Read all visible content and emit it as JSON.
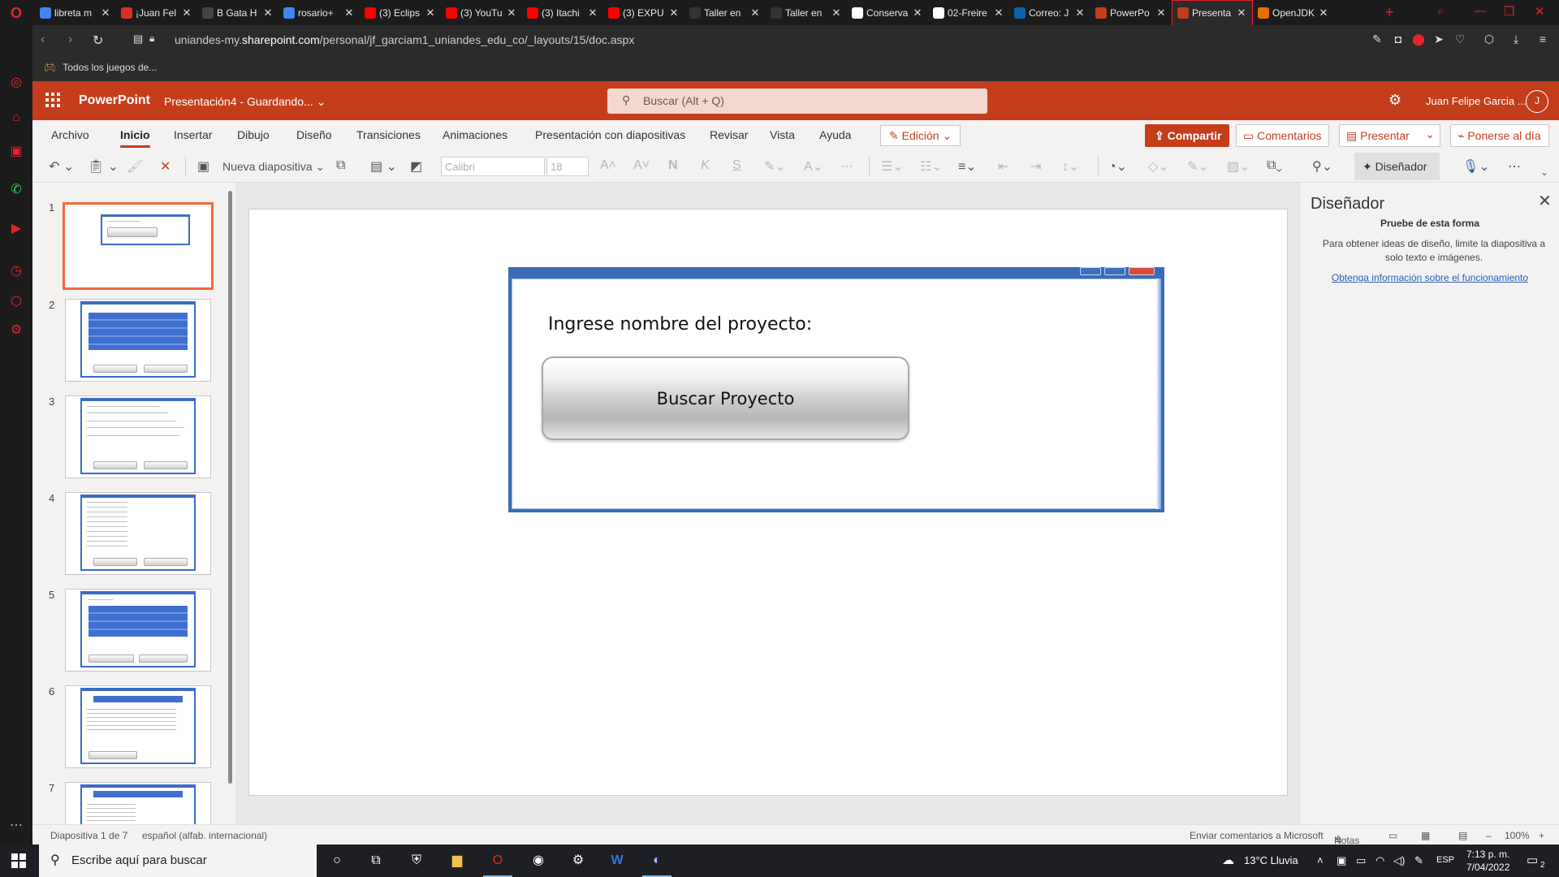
{
  "browser": {
    "tabs": [
      {
        "label": "libreta m",
        "icon": "google-icon",
        "color": "#4285f4"
      },
      {
        "label": "¡Juan Fel",
        "icon": "gmail-icon",
        "color": "#d93025"
      },
      {
        "label": "B Gata H",
        "icon": "af-icon",
        "color": "#444444"
      },
      {
        "label": "rosario+",
        "icon": "google-icon",
        "color": "#4285f4"
      },
      {
        "label": "(3) Eclips",
        "icon": "youtube-icon",
        "color": "#ff0000"
      },
      {
        "label": "(3) YouTu",
        "icon": "youtube-icon",
        "color": "#ff0000"
      },
      {
        "label": "(3) Itachi",
        "icon": "youtube-icon",
        "color": "#ff0000"
      },
      {
        "label": "(3) EXPU",
        "icon": "youtube-icon",
        "color": "#ff0000"
      },
      {
        "label": "Taller en",
        "icon": "dtl-icon",
        "color": "#333333"
      },
      {
        "label": "Taller en",
        "icon": "dtl-icon",
        "color": "#333333"
      },
      {
        "label": "Conserva",
        "icon": "chatgpt-icon",
        "color": "#ffffff"
      },
      {
        "label": "02-Freire",
        "icon": "github-icon",
        "color": "#ffffff"
      },
      {
        "label": "Correo: J",
        "icon": "outlook-icon",
        "color": "#0a64ad"
      },
      {
        "label": "PowerPo",
        "icon": "powerpoint-icon",
        "color": "#c43e1c"
      },
      {
        "label": "Presenta",
        "icon": "powerpoint-icon",
        "color": "#c43e1c",
        "active": true
      },
      {
        "label": "OpenJDK",
        "icon": "java-icon",
        "color": "#e76f00"
      }
    ],
    "url_prefix": "uniandes-my.",
    "url_domain": "sharepoint.com",
    "url_rest": "/personal/jf_garciam1_uniandes_edu_co/_layouts/15/doc.aspx",
    "bookmark": "Todos los juegos de..."
  },
  "ppt": {
    "app_name": "PowerPoint",
    "doc_title": "Presentación4 - Guardando...",
    "search_placeholder": "Buscar (Alt + Q)",
    "user_name": "Juan Felipe Garcia ...",
    "user_initial": "J",
    "menu_tabs": [
      "Archivo",
      "Inicio",
      "Insertar",
      "Dibujo",
      "Diseño",
      "Transiciones",
      "Animaciones",
      "Presentación con diapositivas",
      "Revisar",
      "Vista",
      "Ayuda"
    ],
    "active_tab": "Inicio",
    "edit_mode": "Edición",
    "share": "Compartir",
    "comments": "Comentarios",
    "present": "Presentar",
    "catch_up": "Ponerse al día",
    "ribbon": {
      "new_slide": "Nueva diapositiva",
      "font": "Calibri",
      "font_size": "18",
      "designer": "Diseñador"
    },
    "slide_numbers": [
      "1",
      "2",
      "3",
      "4",
      "5",
      "6",
      "7"
    ],
    "selected_slide": 1,
    "slide": {
      "prompt": "Ingrese nombre del proyecto:",
      "button": "Buscar Proyecto"
    },
    "designer_pane": {
      "title": "Diseñador",
      "heading": "Pruebe de esta forma",
      "body": "Para obtener ideas de diseño, limite la diapositiva a solo texto e imágenes.",
      "link": "Obtenga información sobre el funcionamiento"
    },
    "status": {
      "slide_info": "Diapositiva 1 de 7",
      "language": "español (alfab. internacional)",
      "feedback": "Enviar comentarios a Microsoft",
      "notes": "Notas",
      "zoom": "100%"
    }
  },
  "taskbar": {
    "search_placeholder": "Escribe aquí para buscar",
    "weather": "13°C  Lluvia",
    "lang": "ESP",
    "time": "7:13 p. m.",
    "date": "7/04/2022",
    "notifications": "2"
  }
}
